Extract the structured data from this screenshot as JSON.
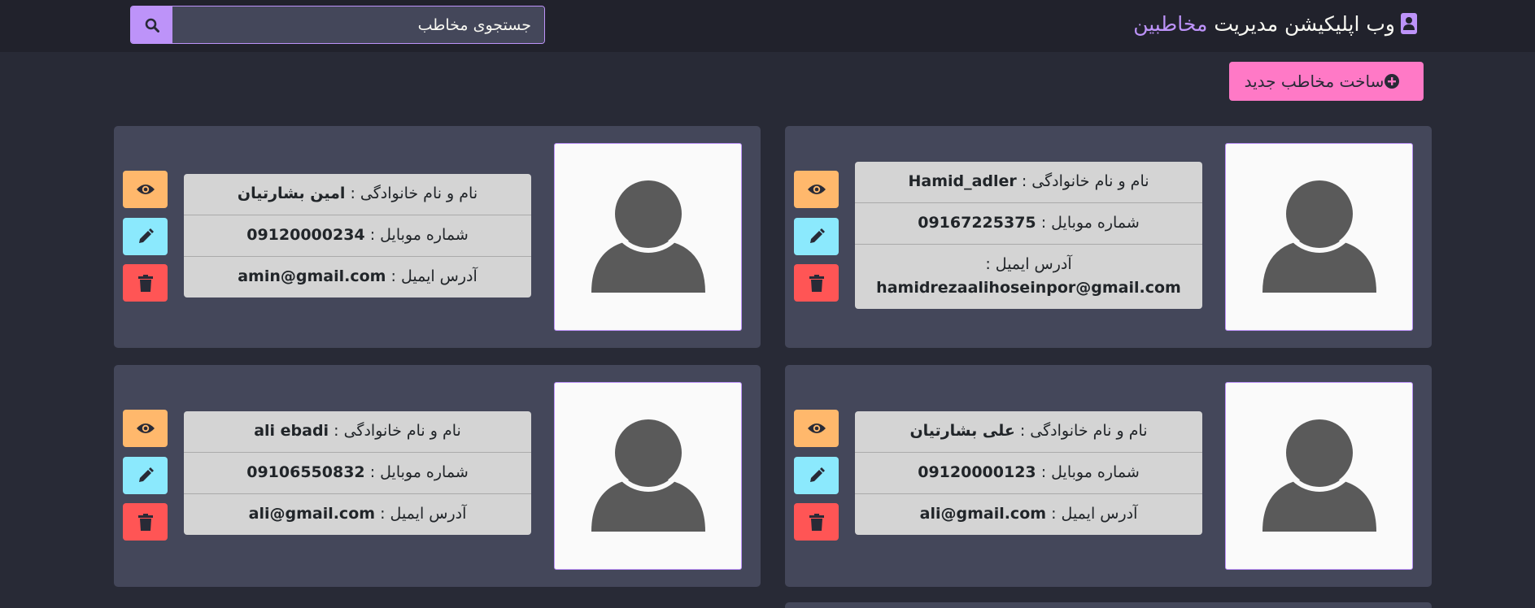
{
  "header": {
    "brand_prefix": "وب اپلیکیشن مدیریت",
    "brand_accent": "مخاطبین",
    "search_placeholder": "جستجوی مخاطب"
  },
  "new_contact_label": "ساخت مخاطب جدید",
  "labels": {
    "fullname": "نام و نام خانوادگی :",
    "mobile": "شماره موبایل :",
    "email": "آدرس ایمیل :"
  },
  "contacts": [
    {
      "fullname": "Hamid_adler",
      "mobile": "09167225375",
      "email": "hamidrezaalihoseinpor@gmail.com"
    },
    {
      "fullname": "امین بشارتیان",
      "mobile": "09120000234",
      "email": "amin@gmail.com"
    },
    {
      "fullname": "علی بشارتیان",
      "mobile": "09120000123",
      "email": "ali@gmail.com"
    },
    {
      "fullname": "ali ebadi",
      "mobile": "09106550832",
      "email": "ali@gmail.com"
    }
  ],
  "colors": {
    "background": "#282a36",
    "navbar": "#21222c",
    "card": "#44475a",
    "purple": "#bd93f9",
    "pink": "#ff79c6",
    "orange": "#ffb86c",
    "cyan": "#8be9fd",
    "red": "#ff5555",
    "info_bg": "#d4d4d4"
  },
  "icons": {
    "brand": "contact-book-icon",
    "search": "search-icon",
    "add": "plus-circle-icon",
    "avatar": "user-silhouette-icon",
    "view": "eye-icon",
    "edit": "pencil-icon",
    "delete": "trash-icon"
  }
}
